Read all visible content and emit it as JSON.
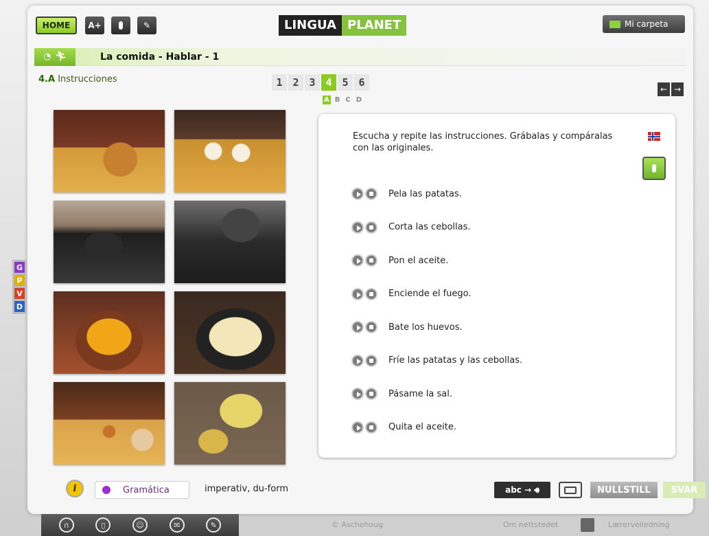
{
  "header": {
    "home_label": "HOME",
    "text_size_label": "A+",
    "logo_left": "LINGUA",
    "logo_right": "PLANET",
    "folder_label": "Mi carpeta"
  },
  "lesson": {
    "title": "La comida - Hablar - 1",
    "section_number": "4.A",
    "section_title": "Instrucciones",
    "pages": [
      "1",
      "2",
      "3",
      "4",
      "5",
      "6"
    ],
    "active_page": "4",
    "subpages": [
      "A",
      "B",
      "C",
      "D"
    ],
    "active_subpage": "A"
  },
  "exercise": {
    "instruction": "Escucha y repite las instrucciones. Grábalas y compáralas con las originales.",
    "items": [
      "Pela las patatas.",
      "Corta las cebollas.",
      "Pon el aceite.",
      "Enciende el fuego.",
      "Bate los huevos.",
      "Fríe las patatas y las cebollas.",
      "Pásame la sal.",
      "Quita el aceite."
    ]
  },
  "side_tabs": [
    {
      "label": "G",
      "color": "#8a3cc5"
    },
    {
      "label": "P",
      "color": "#e0b000"
    },
    {
      "label": "V",
      "color": "#d2442a"
    },
    {
      "label": "D",
      "color": "#2a62c5"
    }
  ],
  "bottom": {
    "grammar_label": "Gramática",
    "grammar_info": "imperativ, du-form",
    "abc_label": "abc",
    "reset_label": "NULLSTILL",
    "answer_label": "SVAR"
  },
  "footer": {
    "copyright": "© Aschehoug",
    "about": "Om nettstedet",
    "teacher_guide": "Lærerveiledning"
  },
  "colors": {
    "accent_green": "#8ccc22",
    "grammar_purple": "#a02ccf"
  }
}
